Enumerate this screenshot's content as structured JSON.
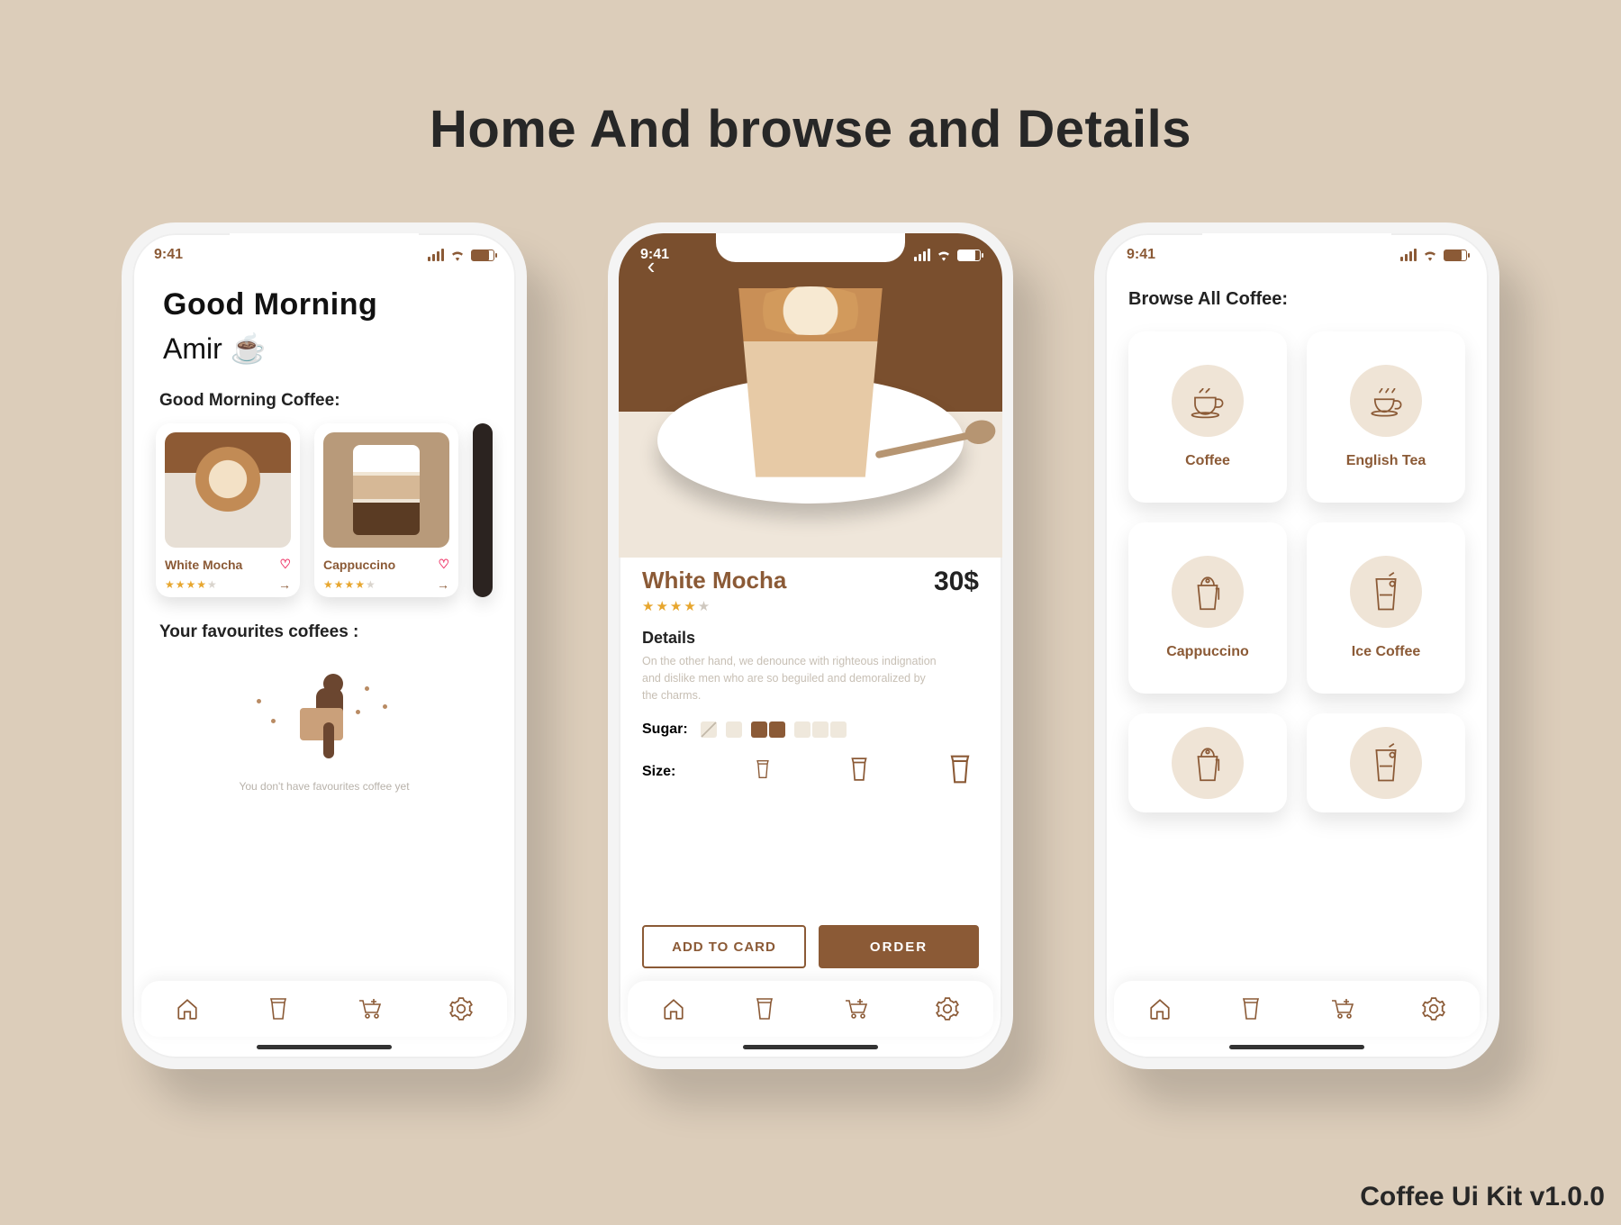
{
  "page_title": "Home And browse and Details",
  "footer": "Coffee Ui Kit v1.0.0",
  "status_time": "9:41",
  "home": {
    "greeting_line1": "Good Morning",
    "greeting_line2": "Amir ☕",
    "section_morning": "Good Morning Coffee:",
    "cards": [
      {
        "name": "White Mocha",
        "rating": 4
      },
      {
        "name": "Cappuccino",
        "rating": 4
      }
    ],
    "section_fav": "Your favourites coffees :",
    "fav_empty_caption": "You don't have favourites coffee yet"
  },
  "detail": {
    "product_name": "White Mocha",
    "price": "30$",
    "rating": 4,
    "details_heading": "Details",
    "description": "On the other hand, we denounce with righteous indignation and dislike men who are so beguiled and demoralized by the charms.",
    "sugar_label": "Sugar:",
    "size_label": "Size:",
    "add_to_card": "ADD TO CARD",
    "order": "ORDER"
  },
  "browse": {
    "heading": "Browse All Coffee:",
    "categories": [
      "Coffee",
      "English Tea",
      "Cappuccino",
      "Ice Coffee",
      "",
      ""
    ]
  }
}
